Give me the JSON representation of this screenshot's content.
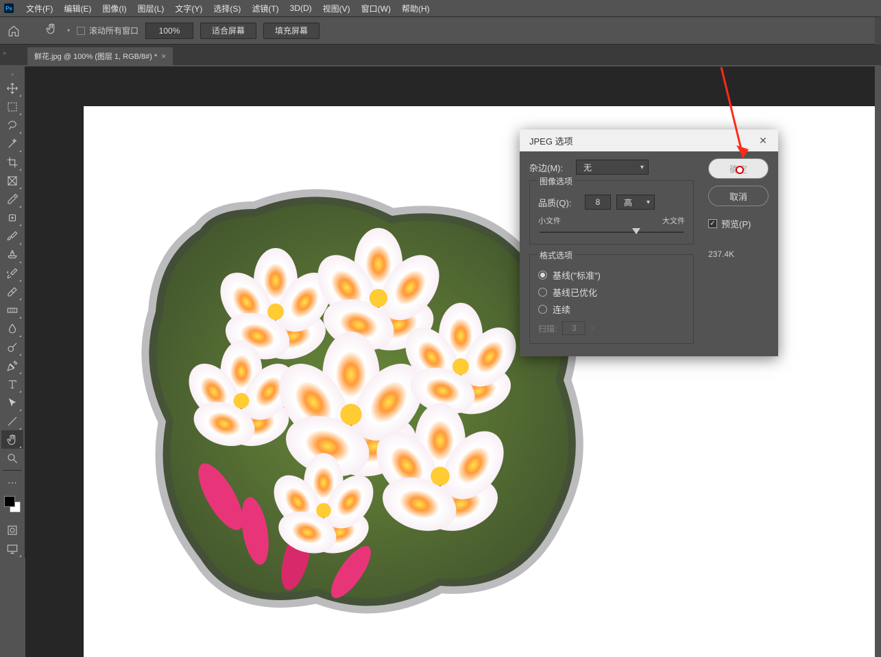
{
  "menubar": {
    "items": [
      "文件(F)",
      "编辑(E)",
      "图像(I)",
      "图层(L)",
      "文字(Y)",
      "选择(S)",
      "滤镜(T)",
      "3D(D)",
      "视图(V)",
      "窗口(W)",
      "帮助(H)"
    ]
  },
  "optionsbar": {
    "scroll_all_windows": "滚动所有窗口",
    "zoom_value": "100%",
    "fit_screen": "适合屏幕",
    "fill_screen": "填充屏幕"
  },
  "document_tab": {
    "title": "鲜花.jpg @ 100% (图层 1, RGB/8#) *"
  },
  "tools": [
    {
      "name": "move-tool",
      "active": false
    },
    {
      "name": "marquee-tool",
      "active": false
    },
    {
      "name": "lasso-tool",
      "active": false
    },
    {
      "name": "magic-wand-tool",
      "active": false
    },
    {
      "name": "crop-tool",
      "active": false
    },
    {
      "name": "frame-tool",
      "active": false
    },
    {
      "name": "eyedropper-tool",
      "active": false
    },
    {
      "name": "healing-brush-tool",
      "active": false
    },
    {
      "name": "brush-tool",
      "active": false
    },
    {
      "name": "clone-stamp-tool",
      "active": false
    },
    {
      "name": "history-brush-tool",
      "active": false
    },
    {
      "name": "eraser-tool",
      "active": false
    },
    {
      "name": "gradient-tool",
      "active": false
    },
    {
      "name": "blur-tool",
      "active": false
    },
    {
      "name": "dodge-tool",
      "active": false
    },
    {
      "name": "pen-tool",
      "active": false
    },
    {
      "name": "type-tool",
      "active": false
    },
    {
      "name": "path-selection-tool",
      "active": false
    },
    {
      "name": "line-tool",
      "active": false
    },
    {
      "name": "hand-tool",
      "active": true
    },
    {
      "name": "zoom-tool",
      "active": false
    }
  ],
  "dialog": {
    "title": "JPEG 选项",
    "matte_label": "杂边(M):",
    "matte_value": "无",
    "image_options_group": "图像选项",
    "quality_label": "品质(Q):",
    "quality_value": "8",
    "quality_preset": "高",
    "small_file": "小文件",
    "large_file": "大文件",
    "slider_position_percent": 67,
    "format_options_group": "格式选项",
    "format_baseline_std": "基线(\"标准\")",
    "format_baseline_opt": "基线已优化",
    "format_progressive": "连续",
    "scans_label": "扫描:",
    "scans_value": "3",
    "ok_label": "确定",
    "cancel_label": "取消",
    "preview_label": "预览(P)",
    "file_size": "237.4K"
  }
}
